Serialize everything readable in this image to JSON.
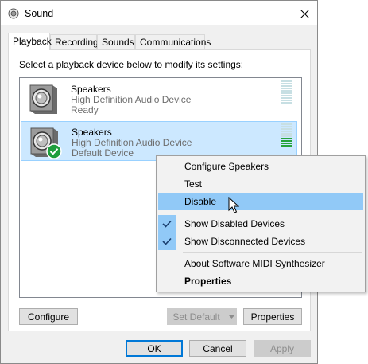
{
  "window": {
    "title": "Sound"
  },
  "tabs": [
    {
      "label": "Playback"
    },
    {
      "label": "Recording"
    },
    {
      "label": "Sounds"
    },
    {
      "label": "Communications"
    }
  ],
  "panel": {
    "instruction": "Select a playback device below to modify its settings:"
  },
  "devices": [
    {
      "name": "Speakers",
      "description": "High Definition Audio Device",
      "status": "Ready",
      "level": 0,
      "selected": false
    },
    {
      "name": "Speakers",
      "description": "High Definition Audio Device",
      "status": "Default Device",
      "level": 0.4,
      "selected": true
    }
  ],
  "panel_buttons": {
    "configure": "Configure",
    "set_default": "Set Default",
    "properties": "Properties"
  },
  "dialog_buttons": {
    "ok": "OK",
    "cancel": "Cancel",
    "apply": "Apply"
  },
  "context_menu": {
    "items": [
      {
        "label": "Configure Speakers"
      },
      {
        "label": "Test"
      },
      {
        "label": "Disable",
        "hover": true
      },
      {
        "label": "Show Disabled Devices",
        "checked": true
      },
      {
        "label": "Show Disconnected Devices",
        "checked": true
      },
      {
        "label": "About Software MIDI Synthesizer"
      },
      {
        "label": "Properties",
        "bold": true
      }
    ]
  },
  "colors": {
    "selection": "#cce8ff",
    "menu_hover": "#91c9f7",
    "default_badge": "#1e9e3c",
    "accent": "#0078d7"
  }
}
